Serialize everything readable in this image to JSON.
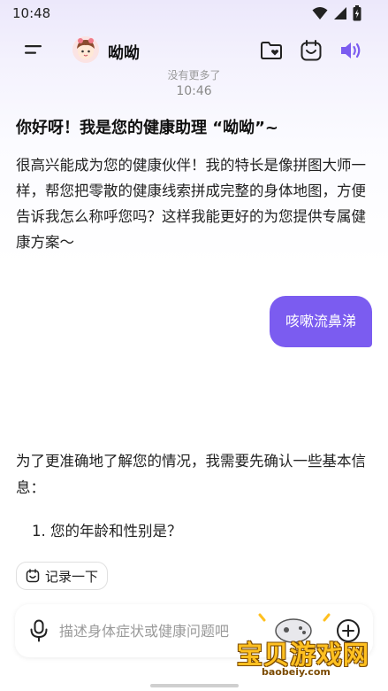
{
  "status_bar": {
    "time": "10:48"
  },
  "header": {
    "title": "呦呦"
  },
  "chat": {
    "no_more": "没有更多了",
    "timestamp": "10:46",
    "greeting_title": "你好呀！我是您的健康助理 “呦呦”~",
    "greeting_body": "很高兴能成为您的健康伙伴！我的特长是像拼图大师一样，帮您把零散的健康线索拼成完整的身体地图，方便告诉我怎么称呼您吗？这样我能更好的为您提供专属健康方案～",
    "user_message": "咳嗽流鼻涕",
    "reply_body": "为了更准确地了解您的情况，我需要先确认一些基本信息：",
    "reply_question": "1. 您的年龄和性别是？"
  },
  "record_chip": {
    "label": "记录一下"
  },
  "input": {
    "placeholder": "描述身体症状或健康问题吧"
  },
  "watermark": {
    "text": "宝贝游戏网",
    "url": "baobeiy.com"
  },
  "colors": {
    "accent": "#7b5cf0",
    "watermark": "#ffc020"
  },
  "icons": [
    "wifi-icon",
    "signal-icon",
    "battery-icon",
    "menu-icon",
    "folder-heart-icon",
    "smile-calendar-icon",
    "speaker-icon",
    "record-icon",
    "mic-icon",
    "plus-icon",
    "game-controller-icon"
  ]
}
